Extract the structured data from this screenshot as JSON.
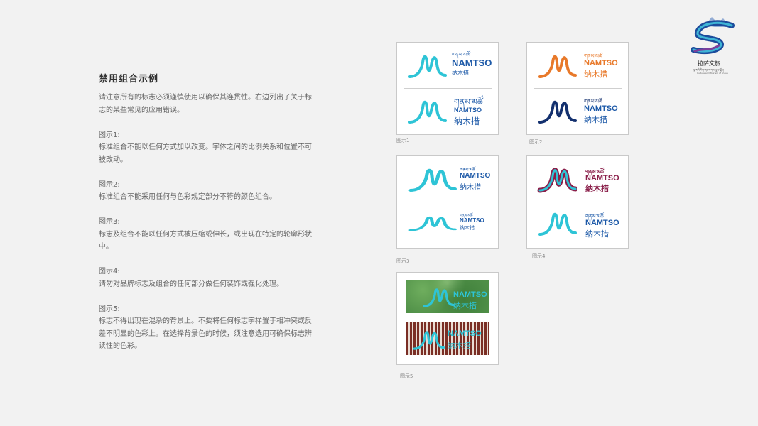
{
  "section_title": "禁用组合示例",
  "intro": "请注意所有的标志必须谨慎使用以确保其连贯性。右边列出了关于标志的某些常见的应用错误。",
  "rules": [
    {
      "heading": "图示1:",
      "body": "标准组合不能以任何方式加以改变。字体之间的比例关系和位置不可被改动。"
    },
    {
      "heading": "图示2:",
      "body": "标准组合不能采用任何与色彩规定部分不符的颜色组合。"
    },
    {
      "heading": "图示3:",
      "body": "标志及组合不能以任何方式被压缩或伸长，或出现在特定的轮廓形状中。"
    },
    {
      "heading": "图示4:",
      "body": "请勿对品牌标志及组合的任何部分做任何装饰或强化处理。"
    },
    {
      "heading": "图示5:",
      "body": "标志不得出现在混杂的背景上。不要将任何标志字样置于相冲突或反差不明显的色彩上。在选择背景色的时候，须注意选用可确保标志辨读性的色彩。"
    }
  ],
  "captions": [
    "图示1",
    "图示2",
    "图示3",
    "图示4",
    "图示5"
  ],
  "logo": {
    "tibetan": "གནམ་མཚོ",
    "latin": "NAMTSO",
    "chinese": "纳木措"
  },
  "brand": {
    "script": "拉萨文旅",
    "tibetan": "ལྷ་སའི་རིག་གནས་དང་ཡུལ་སྐོར།",
    "english": "Culture and Tourism of Lhasa"
  },
  "colors": {
    "teal": "#2ec4d6",
    "blue": "#1e5aa8",
    "orange": "#e8792a",
    "navy": "#13306e",
    "maroon": "#8a1f4a",
    "background": "#f2f2f2"
  }
}
